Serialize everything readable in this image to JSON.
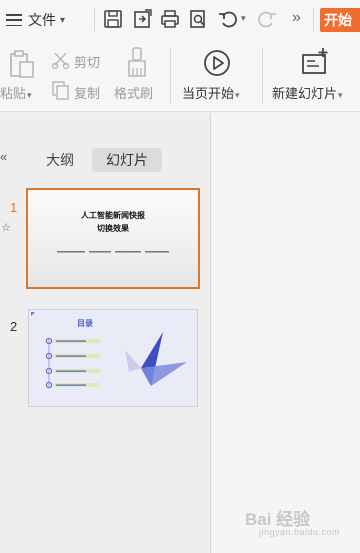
{
  "topbar": {
    "menu_label": "文件",
    "start_tab": "开始",
    "more_glyph": "»"
  },
  "ribbon": {
    "paste": "粘贴",
    "cut": "剪切",
    "copy": "复制",
    "format_painter": "格式刷",
    "play_from_current": "当页开始",
    "new_slide": "新建幻灯片"
  },
  "pane": {
    "collapse_glyph": "«",
    "tab_outline": "大纲",
    "tab_slides": "幻灯片",
    "star_glyph": "☆"
  },
  "slides": [
    {
      "number": "1",
      "title_line1": "人工智能新闻快报",
      "title_line2": "切换效果"
    },
    {
      "number": "2",
      "heading": "目录"
    }
  ],
  "watermark": {
    "main": "Bai 经验",
    "sub": "jingyan.baidu.com"
  },
  "colors": {
    "accent": "#f06d2f",
    "selected_border": "#d9772e",
    "slide_blue": "#4a5fc1"
  }
}
